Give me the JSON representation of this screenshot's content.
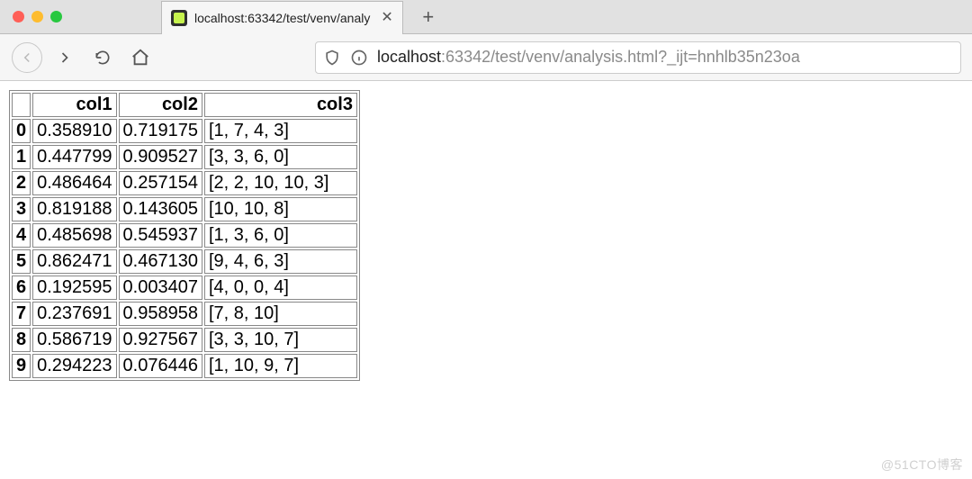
{
  "window": {
    "title": "localhost:63342/test/venv/analy"
  },
  "toolbar": {
    "back_label": "Back",
    "forward_label": "Forward",
    "reload_label": "Reload",
    "home_label": "Home",
    "shield_label": "Tracking protection",
    "info_label": "Site information",
    "new_tab_label": "+"
  },
  "url": {
    "host": "localhost",
    "rest": ":63342/test/venv/analysis.html?_ijt=hnhlb35n23oa"
  },
  "table": {
    "columns": [
      "col1",
      "col2",
      "col3"
    ],
    "rows": [
      {
        "idx": "0",
        "col1": "0.358910",
        "col2": "0.719175",
        "col3": "[1, 7, 4, 3]"
      },
      {
        "idx": "1",
        "col1": "0.447799",
        "col2": "0.909527",
        "col3": "[3, 3, 6, 0]"
      },
      {
        "idx": "2",
        "col1": "0.486464",
        "col2": "0.257154",
        "col3": "[2, 2, 10, 10, 3]"
      },
      {
        "idx": "3",
        "col1": "0.819188",
        "col2": "0.143605",
        "col3": "[10, 10, 8]"
      },
      {
        "idx": "4",
        "col1": "0.485698",
        "col2": "0.545937",
        "col3": "[1, 3, 6, 0]"
      },
      {
        "idx": "5",
        "col1": "0.862471",
        "col2": "0.467130",
        "col3": "[9, 4, 6, 3]"
      },
      {
        "idx": "6",
        "col1": "0.192595",
        "col2": "0.003407",
        "col3": "[4, 0, 0, 4]"
      },
      {
        "idx": "7",
        "col1": "0.237691",
        "col2": "0.958958",
        "col3": "[7, 8, 10]"
      },
      {
        "idx": "8",
        "col1": "0.586719",
        "col2": "0.927567",
        "col3": "[3, 3, 10, 7]"
      },
      {
        "idx": "9",
        "col1": "0.294223",
        "col2": "0.076446",
        "col3": "[1, 10, 9, 7]"
      }
    ]
  },
  "watermark": "@51CTO博客"
}
